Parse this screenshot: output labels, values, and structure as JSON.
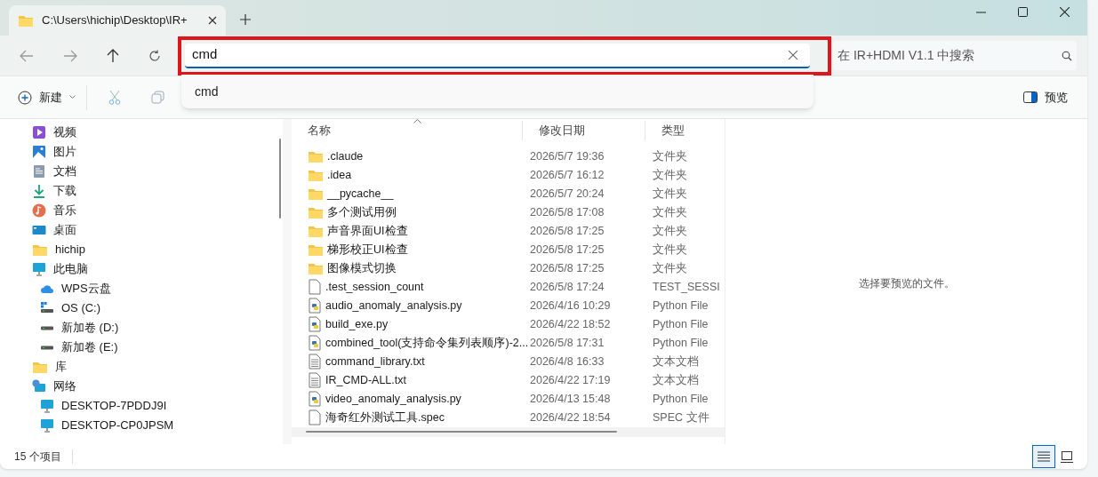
{
  "tab": {
    "title": "C:\\Users\\hichip\\Desktop\\IR+"
  },
  "address": {
    "value": "cmd",
    "highlighted": true
  },
  "search": {
    "placeholder": "在 IR+HDMI V1.1 中搜索"
  },
  "suggestions": [
    "cmd"
  ],
  "toolbar": {
    "new_label": "新建",
    "preview_label": "预览"
  },
  "sidebar": [
    {
      "label": "视频",
      "kind": "video"
    },
    {
      "label": "图片",
      "kind": "picture"
    },
    {
      "label": "文档",
      "kind": "document"
    },
    {
      "label": "下载",
      "kind": "download"
    },
    {
      "label": "音乐",
      "kind": "music"
    },
    {
      "label": "桌面",
      "kind": "desktop"
    },
    {
      "label": "hichip",
      "kind": "folder"
    },
    {
      "label": "此电脑",
      "kind": "pc",
      "children": [
        {
          "label": "WPS云盘",
          "kind": "cloud"
        },
        {
          "label": "OS (C:)",
          "kind": "osdrive"
        },
        {
          "label": "新加卷 (D:)",
          "kind": "drive"
        },
        {
          "label": "新加卷 (E:)",
          "kind": "drive"
        }
      ]
    },
    {
      "label": "库",
      "kind": "folder"
    },
    {
      "label": "网络",
      "kind": "network",
      "children": [
        {
          "label": "DESKTOP-7PDDJ9I",
          "kind": "pc"
        },
        {
          "label": "DESKTOP-CP0JPSM",
          "kind": "pc"
        }
      ]
    }
  ],
  "table": {
    "columns": [
      "名称",
      "修改日期",
      "类型"
    ],
    "rows": [
      {
        "name": ".claude",
        "date": "2026/5/7 19:36",
        "type": "文件夹",
        "kind": "folder"
      },
      {
        "name": ".idea",
        "date": "2026/5/7 16:12",
        "type": "文件夹",
        "kind": "folder"
      },
      {
        "name": "__pycache__",
        "date": "2026/5/7 20:24",
        "type": "文件夹",
        "kind": "folder"
      },
      {
        "name": "多个测试用例",
        "date": "2026/5/8 17:08",
        "type": "文件夹",
        "kind": "folder"
      },
      {
        "name": "声音界面UI检查",
        "date": "2026/5/8 17:25",
        "type": "文件夹",
        "kind": "folder"
      },
      {
        "name": "梯形校正UI检查",
        "date": "2026/5/8 17:25",
        "type": "文件夹",
        "kind": "folder"
      },
      {
        "name": "图像模式切换",
        "date": "2026/5/8 17:25",
        "type": "文件夹",
        "kind": "folder"
      },
      {
        "name": ".test_session_count",
        "date": "2026/5/8 17:24",
        "type": "TEST_SESSI",
        "kind": "file"
      },
      {
        "name": "audio_anomaly_analysis.py",
        "date": "2026/4/16 10:29",
        "type": "Python File",
        "kind": "python"
      },
      {
        "name": "build_exe.py",
        "date": "2026/4/22 18:52",
        "type": "Python File",
        "kind": "python"
      },
      {
        "name": "combined_tool(支持命令集列表顺序)-2...",
        "date": "2026/5/8 17:31",
        "type": "Python File",
        "kind": "python"
      },
      {
        "name": "command_library.txt",
        "date": "2026/4/8 16:33",
        "type": "文本文档",
        "kind": "text"
      },
      {
        "name": "IR_CMD-ALL.txt",
        "date": "2026/4/22 17:19",
        "type": "文本文档",
        "kind": "text"
      },
      {
        "name": "video_anomaly_analysis.py",
        "date": "2026/4/13 15:48",
        "type": "Python File",
        "kind": "python"
      },
      {
        "name": "海奇红外测试工具.spec",
        "date": "2026/4/22 18:54",
        "type": "SPEC 文件",
        "kind": "file"
      }
    ]
  },
  "preview": {
    "message": "选择要预览的文件。"
  },
  "status_bar": {
    "count": "15 个项目"
  },
  "view_buttons": [
    {
      "kind": "details",
      "selected": true
    },
    {
      "kind": "tiles",
      "selected": false
    }
  ]
}
